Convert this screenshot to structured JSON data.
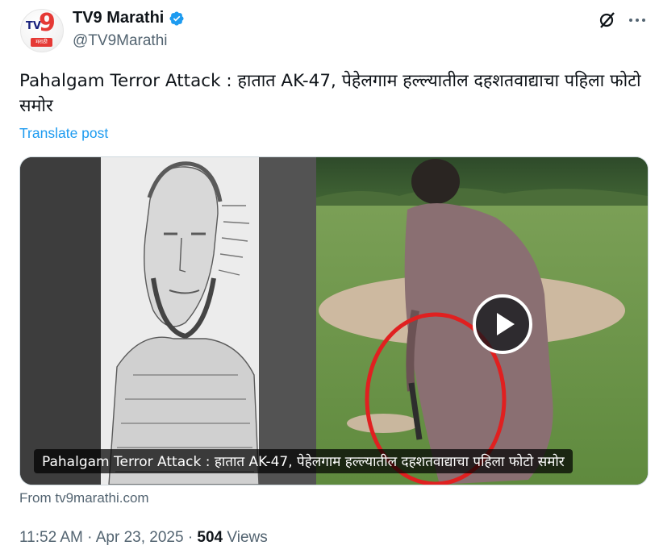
{
  "account": {
    "name": "TV9 Marathi",
    "handle": "@TV9Marathi",
    "avatar_text_tv": "TV",
    "avatar_text_9": "9",
    "avatar_text_lang": "मराठी",
    "verified_color": "#1d9bf0"
  },
  "post": {
    "text": "Pahalgam Terror Attack : हातात AK-47, पेहेलगाम हल्ल्यातील दहशतवाद्याचा पहिला फोटो समोर",
    "translate_label": "Translate post"
  },
  "media": {
    "caption": "Pahalgam Terror Attack : हातात AK-47, पेहेलगाम हल्ल्यातील दहशतवाद्याचा पहिला फोटो समोर",
    "source": "From tv9marathi.com"
  },
  "meta": {
    "time": "11:52 AM",
    "date": "Apr 23, 2025",
    "separator": "·",
    "views_count": "504",
    "views_label": "Views"
  },
  "icons": {
    "grok": "grok-icon",
    "more": "more-icon",
    "verified": "verified-badge-icon",
    "play": "play-icon"
  },
  "colors": {
    "link": "#1d9bf0",
    "secondary_text": "#536471",
    "primary_text": "#0f1419",
    "annotation_circle": "#e02020"
  }
}
